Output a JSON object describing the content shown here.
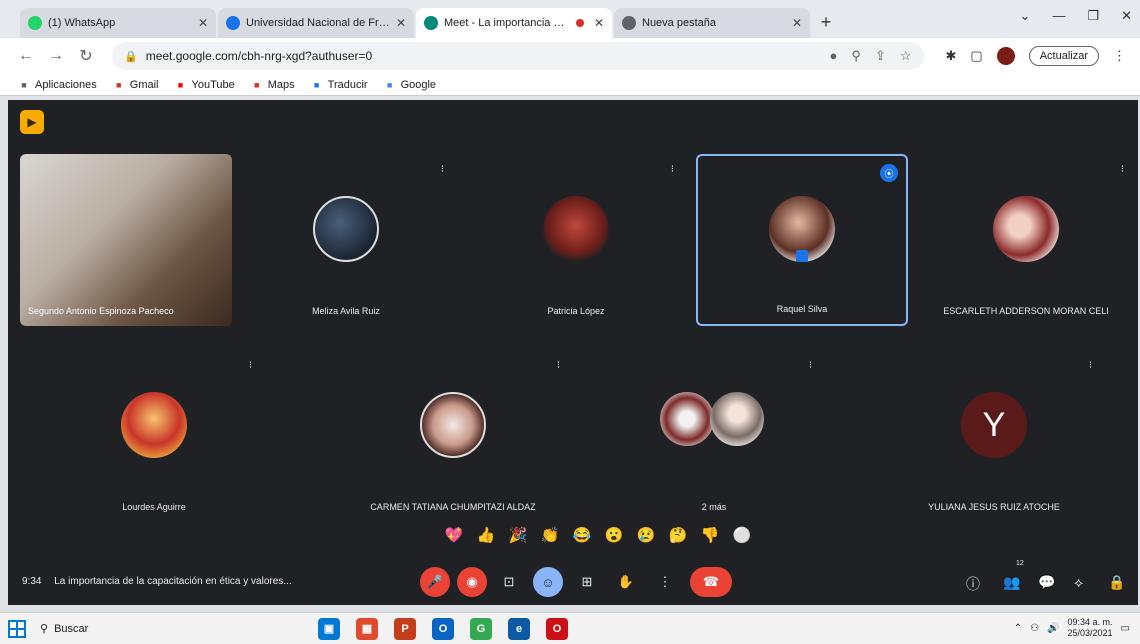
{
  "browser": {
    "tabs": [
      {
        "label": "(1) WhatsApp",
        "favicon_color": "#25d366",
        "active": false
      },
      {
        "label": "Universidad Nacional de Frontera",
        "favicon_color": "#1a73e8",
        "active": false
      },
      {
        "label": "Meet - La importancia de la",
        "favicon_color": "#00897b",
        "active": true,
        "recording": true
      },
      {
        "label": "Nueva pestaña",
        "favicon_color": "#5f6368",
        "active": false
      }
    ],
    "new_tab_symbol": "+",
    "url": "meet.google.com/cbh-nrg-xgd?authuser=0",
    "update_label": "Actualizar",
    "bookmarks": [
      {
        "label": "Aplicaciones",
        "icon": "apps-grid-icon",
        "color": "#5f6368"
      },
      {
        "label": "Gmail",
        "icon": "gmail-icon",
        "color": "#d93025"
      },
      {
        "label": "YouTube",
        "icon": "youtube-icon",
        "color": "#ff0000"
      },
      {
        "label": "Maps",
        "icon": "maps-pin-icon",
        "color": "#d93025"
      },
      {
        "label": "Traducir",
        "icon": "translate-icon",
        "color": "#1a73e8"
      },
      {
        "label": "Google",
        "icon": "google-icon",
        "color": "#4285f4"
      }
    ]
  },
  "meet": {
    "participants_row1": [
      {
        "name": "Segundo Antonio Espinoza Pacheco",
        "type": "video"
      },
      {
        "name": "Meliza Avila Ruiz",
        "type": "avatar",
        "avatar": "av-photo1"
      },
      {
        "name": "Patricia López",
        "type": "avatar",
        "avatar": "av-photo2"
      },
      {
        "name": "Raquel Silva",
        "type": "avatar",
        "avatar": "av-photo3",
        "speaking": true
      },
      {
        "name": "ESCARLETH ADDERSON MORAN CELI",
        "type": "avatar",
        "avatar": "av-photo4"
      }
    ],
    "participants_row2": [
      {
        "name": "Lourdes Aguirre",
        "type": "avatar",
        "avatar": "av-photo5"
      },
      {
        "name": "CARMEN TATIANA CHUMPITAZI ALDAZ",
        "type": "avatar",
        "avatar": "av-photo6"
      },
      {
        "name": "2 más",
        "type": "pair"
      },
      {
        "name": "YULIANA JESUS RUIZ ATOCHE",
        "type": "initial",
        "initial": "Y"
      }
    ],
    "reactions": [
      "💖",
      "👍",
      "🎉",
      "👏",
      "😂",
      "😮",
      "😢",
      "🤔",
      "👎",
      "⚪"
    ],
    "time": "9:34",
    "meeting_title": "La importancia de la capacitación en ética y valores...",
    "participant_count": "12"
  },
  "taskbar": {
    "search_label": "Buscar",
    "apps": [
      {
        "icon": "task-view-icon",
        "color": "#0078d4",
        "glyph": "▣"
      },
      {
        "icon": "store-icon",
        "color": "#e04a2f",
        "glyph": "▦"
      },
      {
        "icon": "powerpoint-icon",
        "color": "#c43e1c",
        "glyph": "P"
      },
      {
        "icon": "outlook-icon",
        "color": "#0a64c4",
        "glyph": "O"
      },
      {
        "icon": "chrome-icon",
        "color": "#34a853",
        "glyph": "G"
      },
      {
        "icon": "edge-icon",
        "color": "#0c59a4",
        "glyph": "e"
      },
      {
        "icon": "opera-icon",
        "color": "#cc0f16",
        "glyph": "O"
      }
    ],
    "time": "09:34 a. m.",
    "date": "25/03/2021"
  }
}
